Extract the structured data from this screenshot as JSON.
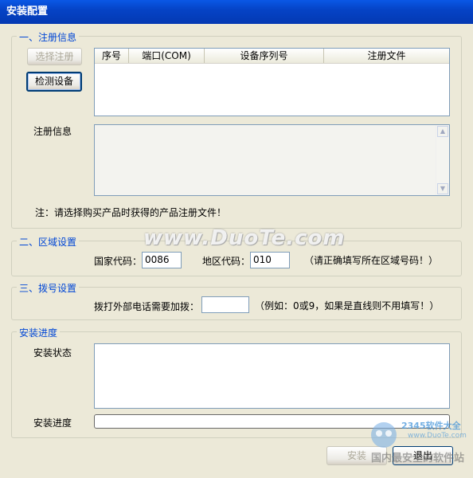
{
  "window": {
    "title": "安装配置"
  },
  "registration": {
    "legend": "一、注册信息",
    "select_button": "选择注册",
    "detect_button": "检测设备",
    "columns": [
      "序号",
      "端口(COM)",
      "设备序列号",
      "注册文件"
    ],
    "info_label": "注册信息",
    "note": "注：请选择购买产品时获得的产品注册文件！"
  },
  "region": {
    "legend": "二、区域设置",
    "country_label": "国家代码：",
    "country_value": "0086",
    "area_label": "地区代码：",
    "area_value": "010",
    "hint": "（请正确填写所在区域号码！）"
  },
  "dial": {
    "legend": "三、拨号设置",
    "prefix_label": "拨打外部电话需要加拨：",
    "prefix_value": "",
    "hint": "（例如：0或9，如果是直线则不用填写！）"
  },
  "progress": {
    "legend": "安装进度",
    "status_label": "安装状态",
    "progress_label": "安装进度",
    "value": 0
  },
  "footer": {
    "install_button": "安装",
    "exit_button": "退出"
  },
  "watermarks": {
    "duote": "www.DuoTe.com",
    "logo_2345": "2345软件大全",
    "logo_url": "www.DuoTe.com",
    "corner": "国内最安全的软件站"
  }
}
